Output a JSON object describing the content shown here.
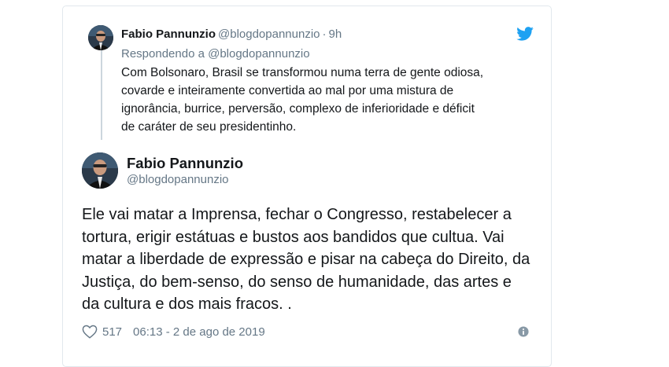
{
  "quoted_tweet": {
    "author_name": "Fabio Pannunzio",
    "handle": "@blogdopannunzio",
    "separator": "·",
    "time": "9h",
    "replying_to": "Respondendo a @blogdopannunzio",
    "body_lines": [
      "Com Bolsonaro, Brasil se transformou numa terra de gente odiosa,",
      "covarde e inteiramente convertida ao mal por uma mistura de",
      "ignorância, burrice, perversão, complexo de inferioridade e déficit",
      "de caráter de seu presidentinho."
    ]
  },
  "main_tweet": {
    "author_name": "Fabio Pannunzio",
    "handle": "@blogdopannunzio",
    "body_lines": [
      "Ele vai matar a Imprensa, fechar o Congresso, restabelecer a",
      "tortura, erigir estátuas e bustos aos bandidos que cultua. Vai",
      "matar a liberdade de expressão e pisar na cabeça do Direito, da",
      "Justiça, do bem-senso, do senso de humanidade, das artes e",
      "da cultura e dos mais fracos. ."
    ],
    "likes": "517",
    "timestamp": "06:13 - 2 de ago de 2019"
  },
  "icons": {
    "brand": "twitter-bird-icon",
    "like": "heart-icon",
    "info": "info-icon"
  },
  "colors": {
    "twitter_blue": "#1da1f2",
    "secondary_text": "#657786",
    "primary_text": "#14171a",
    "border": "#e1e8ed"
  }
}
